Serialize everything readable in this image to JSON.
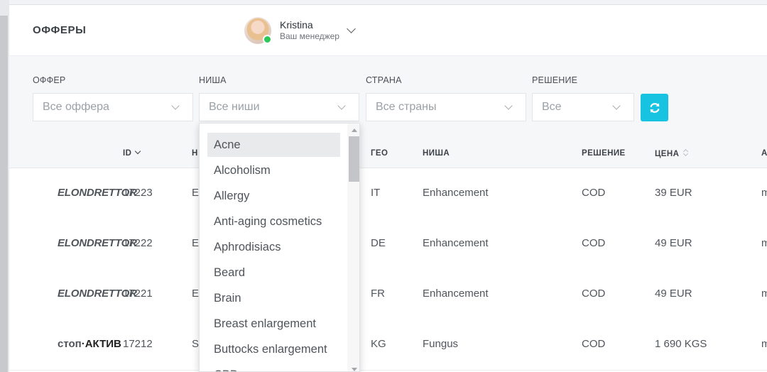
{
  "header": {
    "title": "ОФФЕРЫ",
    "manager": {
      "name": "Kristina",
      "role": "Ваш менеджер"
    }
  },
  "filters": {
    "offer": {
      "label": "ОФФЕР",
      "value": "Все оффера"
    },
    "niche": {
      "label": "НИША",
      "value": "Все ниши"
    },
    "country": {
      "label": "СТРАНА",
      "value": "Все страны"
    },
    "decision": {
      "label": "РЕШЕНИЕ",
      "value": "Все"
    },
    "refresh_icon": "refresh-icon"
  },
  "niche_dropdown": {
    "selected": "Acne",
    "options": [
      "Acne",
      "Alcoholism",
      "Allergy",
      "Anti-aging cosmetics",
      "Aphrodisiacs",
      "Beard",
      "Brain",
      "Breast enlargement",
      "Buttocks enlargement",
      "CBD"
    ]
  },
  "table": {
    "columns": {
      "id": "ID",
      "name": "Н",
      "geo": "ГЕО",
      "niche": "НИША",
      "decision": "РЕШЕНИЕ",
      "price": "ЦЕНА",
      "extra": "А"
    },
    "rows": [
      {
        "logo": "ELONDRETTOR",
        "id": "17223",
        "name": "E",
        "geo": "IT",
        "niche": "Enhancement",
        "decision": "COD",
        "price": "39 EUR",
        "extra": "m"
      },
      {
        "logo": "ELONDRETTOR",
        "id": "17222",
        "name": "E",
        "geo": "DE",
        "niche": "Enhancement",
        "decision": "COD",
        "price": "49 EUR",
        "extra": "m"
      },
      {
        "logo": "ELONDRETTOR",
        "id": "17221",
        "name": "E",
        "geo": "FR",
        "niche": "Enhancement",
        "decision": "COD",
        "price": "49 EUR",
        "extra": "m"
      },
      {
        "logo_part1": "стоп",
        "logo_part2": "·АКТИВ",
        "id": "17212",
        "name": "S",
        "geo": "KG",
        "niche": "Fungus",
        "decision": "COD",
        "price": "1 690 KGS",
        "extra": "m"
      }
    ]
  },
  "colors": {
    "accent": "#18c2e1",
    "online": "#2ec85a"
  }
}
